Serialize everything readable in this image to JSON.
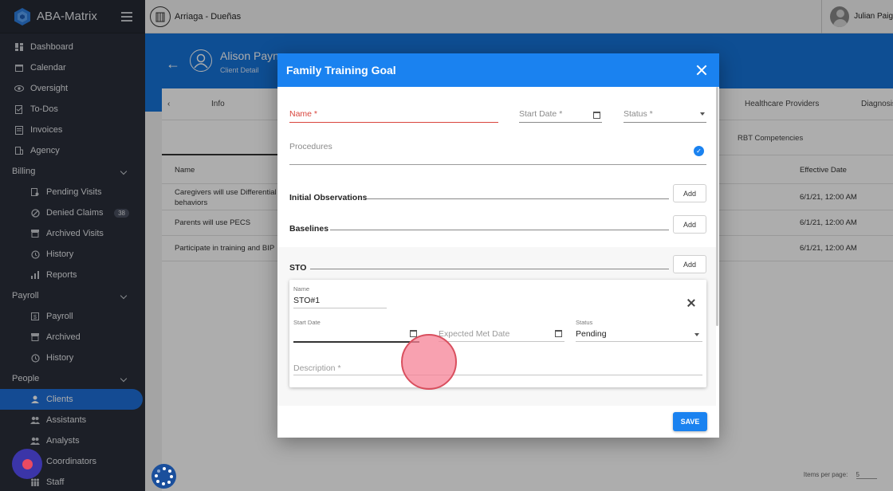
{
  "app": {
    "name": "ABA-Matrix"
  },
  "topbar": {
    "org_name": "Arriaga - Dueñas",
    "user_name": "Julian Paig"
  },
  "sidebar": {
    "items": [
      {
        "label": "Dashboard",
        "icon": "dashboard-icon"
      },
      {
        "label": "Calendar",
        "icon": "calendar-icon"
      },
      {
        "label": "Oversight",
        "icon": "eye-icon"
      },
      {
        "label": "To-Dos",
        "icon": "todo-icon"
      },
      {
        "label": "Invoices",
        "icon": "invoice-icon"
      },
      {
        "label": "Agency",
        "icon": "building-icon"
      }
    ],
    "billing": {
      "label": "Billing",
      "items": [
        {
          "label": "Pending Visits"
        },
        {
          "label": "Denied Claims",
          "badge": "38"
        },
        {
          "label": "Archived Visits"
        },
        {
          "label": "History"
        },
        {
          "label": "Reports"
        }
      ]
    },
    "payroll": {
      "label": "Payroll",
      "items": [
        {
          "label": "Payroll"
        },
        {
          "label": "Archived"
        },
        {
          "label": "History"
        }
      ]
    },
    "people": {
      "label": "People",
      "items": [
        {
          "label": "Clients"
        },
        {
          "label": "Assistants"
        },
        {
          "label": "Analysts"
        },
        {
          "label": "Coordinators"
        },
        {
          "label": "Staff"
        }
      ]
    }
  },
  "client": {
    "name": "Alison Payne",
    "subtitle": "Client Detail"
  },
  "tabs": {
    "info": "Info",
    "healthcare": "Healthcare Providers",
    "diagnosis": "Diagnosis"
  },
  "subtabs": {
    "rbt": "RBT Competencies"
  },
  "table": {
    "headers": {
      "name": "Name",
      "effective": "Effective Date"
    },
    "rows": [
      {
        "name": "Caregivers will use Differential Re",
        "name2": "behaviors",
        "date": "6/1/21, 12:00 AM"
      },
      {
        "name": "Parents will use PECS",
        "date": "6/1/21, 12:00 AM"
      },
      {
        "name": "Participate in training and BIP",
        "date": "6/1/21, 12:00 AM"
      }
    ],
    "items_per_page_label": "Items per page:",
    "items_per_page": "5"
  },
  "dialog": {
    "title": "Family Training Goal",
    "name_label": "Name *",
    "start_date_label": "Start Date *",
    "status_label": "Status *",
    "procedures_label": "Procedures",
    "initial_observations": "Initial Observations",
    "baselines": "Baselines",
    "sto": "STO",
    "add": "Add",
    "save": "SAVE",
    "sto_card": {
      "name_label": "Name",
      "name_value": "STO#1",
      "start_date_label": "Start Date",
      "expected_met_date_label": "Expected Met Date",
      "status_label": "Status",
      "status_value": "Pending",
      "description_label": "Description *"
    }
  },
  "colors": {
    "accent": "#1a82f0",
    "header_blue": "#1673d9",
    "sidebar": "#2a2f3a",
    "error": "#d9453c"
  }
}
